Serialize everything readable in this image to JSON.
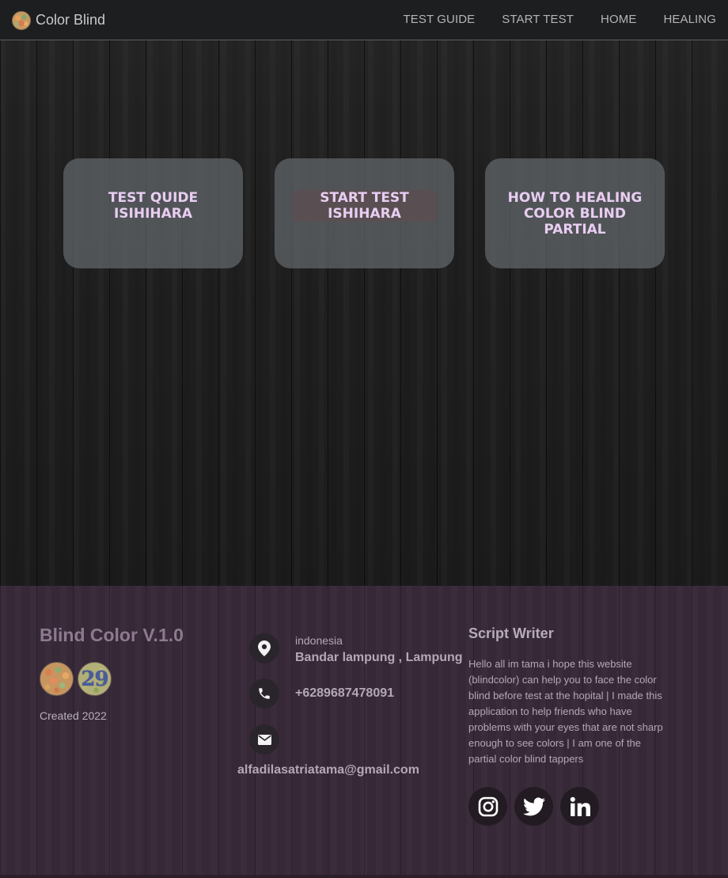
{
  "navbar": {
    "brand": "Color Blind",
    "links": [
      "TEST GUIDE",
      "START TEST",
      "HOME",
      "HEALING"
    ]
  },
  "hero": {
    "cards": [
      {
        "label": "TEST QUIDE\nISIHIHARA"
      },
      {
        "label": "START TEST\nISHIHARA"
      },
      {
        "label": "HOW TO HEALING\nCOLOR BLIND\nPARTIAL"
      }
    ]
  },
  "footer": {
    "title": "Blind Color V.1.0",
    "plate_number": "29",
    "created": "Created 2022",
    "contact": {
      "country": "indonesia",
      "city": "Bandar lampung , Lampung",
      "phone": "+6289687478091",
      "email": "alfadilasatriatama@gmail.com"
    },
    "script_writer": {
      "title": "Script Writer",
      "text": "Hello all im tama i hope this website (blindcolor) can help you to face the color blind before test at the hopital | I made this application to help friends who have problems with your eyes that are not sharp enough to see colors | I am one of the partial color blind tappers"
    },
    "socials": [
      "instagram-icon",
      "twitter-icon",
      "linkedin-icon"
    ]
  },
  "colors": {
    "navbar_bg": "#1d1e20",
    "card_text": "#e9cdf2",
    "footer_bg": "#372838"
  }
}
